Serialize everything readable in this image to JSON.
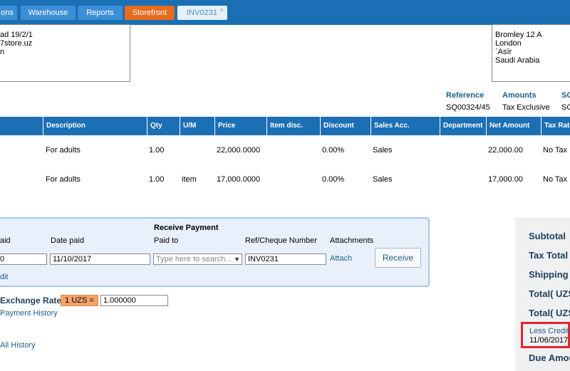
{
  "tabs": [
    {
      "label": "ons"
    },
    {
      "label": "Warehouse"
    },
    {
      "label": "Reports"
    },
    {
      "label": "Storefront"
    },
    {
      "label": "INV0231",
      "close": "×"
    }
  ],
  "from_address": [
    "ad 19/2/1",
    "7store.uz",
    "n"
  ],
  "to_address": [
    "Bromley 12 A",
    "London",
    "`Asīr",
    "Saudi Arabia"
  ],
  "info": {
    "reference_label": "Reference",
    "reference_value": "SQ00324/45",
    "amounts_label": "Amounts",
    "amounts_value": "Tax Exclusive",
    "extra_label": "SO",
    "extra_value": "SC"
  },
  "table": {
    "headers": [
      "Description",
      "Qty",
      "U/M",
      "Price",
      "Item disc.",
      "Discount",
      "Sales Acc.",
      "Department",
      "Net Amount",
      "Tax Rate"
    ],
    "rows": [
      {
        "description": "For adults",
        "qty": "1.00",
        "um": "",
        "price": "22,000.0000",
        "item_disc": "",
        "discount": "0.00%",
        "sales_acc": "Sales",
        "department": "",
        "net_amount": "22,000.00",
        "tax_rate": "No Tax"
      },
      {
        "description": "For adults",
        "qty": "1.00",
        "um": "item",
        "price": "17,000.0000",
        "item_disc": "",
        "discount": "0.00%",
        "sales_acc": "Sales",
        "department": "",
        "net_amount": "17,000.00",
        "tax_rate": "No Tax"
      }
    ]
  },
  "payment": {
    "title": "Receive Payment",
    "amount_label": "aid",
    "amount_value": "0",
    "date_label": "Date paid",
    "date_value": "11/10/2017",
    "paid_to_label": "Paid to",
    "paid_to_placeholder": "Type here to search...",
    "ref_label": "Ref/Cheque Number",
    "ref_value": "INV0231",
    "attachments_label": "Attachments",
    "attach_link": "Attach",
    "receive_button": "Receive",
    "credit_link": "dit"
  },
  "exchange": {
    "label": "Exchange Rate:",
    "currency": "1 UZS =",
    "rate": "1.000000"
  },
  "links": {
    "payment_history": "Payment History",
    "all_history": "All History"
  },
  "totals": {
    "subtotal": "Subtotal",
    "tax_total": "Tax Total",
    "shipping": "Shipping",
    "total1": "Total( UZS",
    "total2": "Total( UZS",
    "less_credit": "Less Credit",
    "credit_date": "11/06/2017",
    "due_amount": "Due Amou"
  },
  "colors": {
    "header_blue": "#1b6fb5",
    "tab_orange": "#e86b1e",
    "link_blue": "#1f5d8c",
    "highlight_red": "#e3252b",
    "rate_orange": "#f5a26a"
  }
}
